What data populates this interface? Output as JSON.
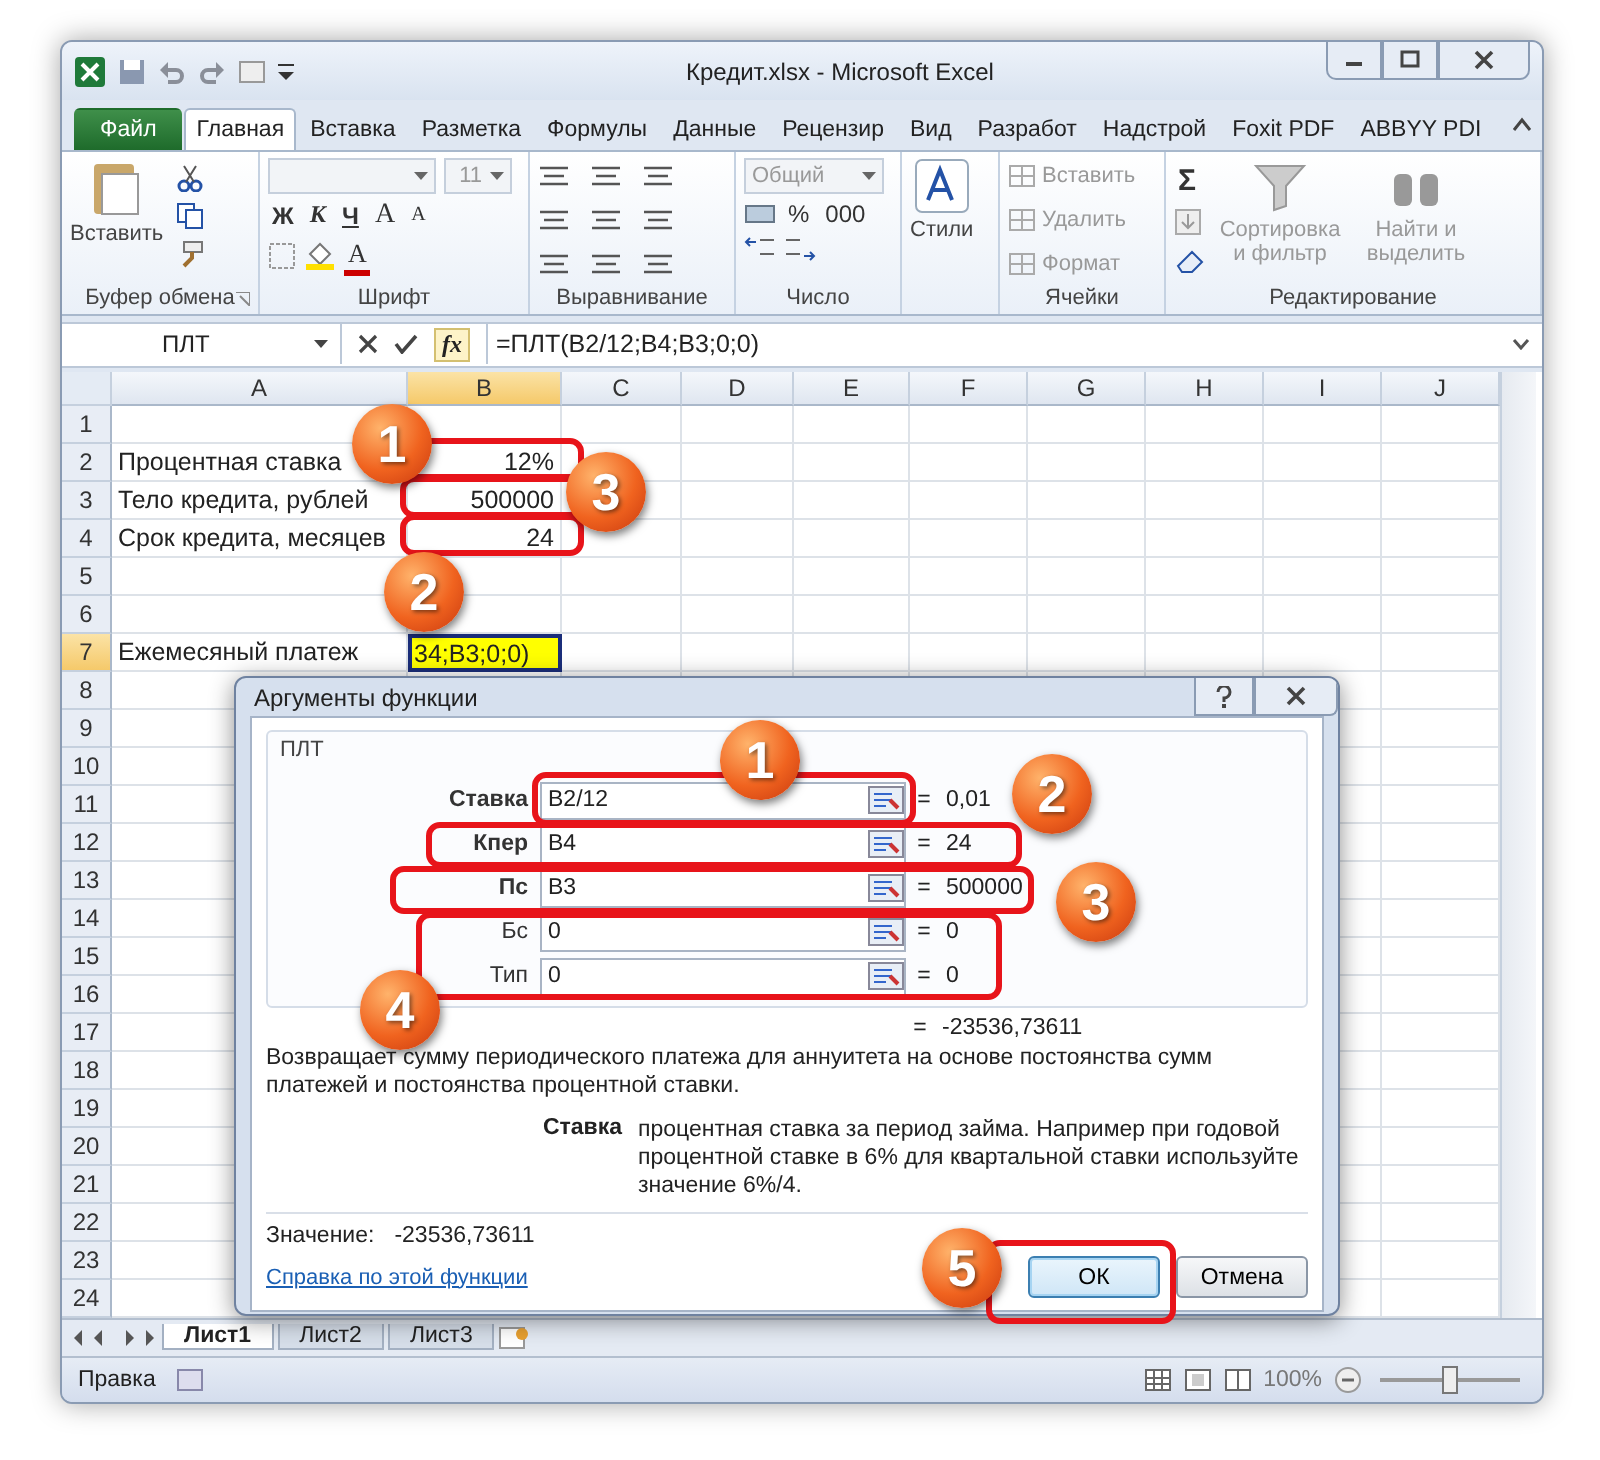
{
  "window": {
    "title": "Кредит.xlsx  -  Microsoft Excel"
  },
  "ribbon_tabs": [
    {
      "label": "Файл",
      "kind": "file",
      "selected": false
    },
    {
      "label": "Главная",
      "kind": "tab",
      "selected": true
    },
    {
      "label": "Вставка",
      "kind": "tab",
      "selected": false
    },
    {
      "label": "Разметка",
      "kind": "tab",
      "selected": false
    },
    {
      "label": "Формулы",
      "kind": "tab",
      "selected": false
    },
    {
      "label": "Данные",
      "kind": "tab",
      "selected": false
    },
    {
      "label": "Рецензир",
      "kind": "tab",
      "selected": false
    },
    {
      "label": "Вид",
      "kind": "tab",
      "selected": false
    },
    {
      "label": "Разработ",
      "kind": "tab",
      "selected": false
    },
    {
      "label": "Надстрой",
      "kind": "tab",
      "selected": false
    },
    {
      "label": "Foxit PDF",
      "kind": "tab",
      "selected": false
    },
    {
      "label": "ABBYY PDI",
      "kind": "tab",
      "selected": false
    }
  ],
  "ribbon": {
    "clipboard": {
      "label": "Буфер обмена",
      "paste": "Вставить"
    },
    "font": {
      "label": "Шрифт",
      "size": "11",
      "styles": [
        "Ж",
        "К",
        "Ч"
      ],
      "grow": "A",
      "shrink": "A",
      "font_color_button": "A"
    },
    "alignment": {
      "label": "Выравнивание"
    },
    "number": {
      "label": "Число",
      "format": "Общий",
      "percent": "%",
      "thousands": "000"
    },
    "styles": {
      "label": "Стили"
    },
    "cells": {
      "label": "Ячейки",
      "items": [
        {
          "label": "Вставить",
          "disabled": true
        },
        {
          "label": "Удалить",
          "disabled": true
        },
        {
          "label": "Формат",
          "disabled": true
        }
      ]
    },
    "editing": {
      "label": "Редактирование",
      "sum": "Σ",
      "items": [
        {
          "label": "Сортировка и фильтр",
          "disabled": true
        },
        {
          "label": "Найти и выделить",
          "disabled": true
        }
      ]
    }
  },
  "formula_bar": {
    "name_box": "ПЛТ",
    "fx": "fx",
    "formula": "=ПЛТ(B2/12;B4;B3;0;0)"
  },
  "columns": [
    "A",
    "B",
    "C",
    "D",
    "E",
    "F",
    "G",
    "H",
    "I",
    "J"
  ],
  "rows": [
    {
      "header": "1",
      "cells": []
    },
    {
      "header": "2",
      "cells": [
        {
          "value": "Процентная ставка",
          "selected": false
        },
        {
          "value": "12%",
          "selected": false
        }
      ]
    },
    {
      "header": "3",
      "cells": [
        {
          "value": "Тело кредита, рублей",
          "selected": false
        },
        {
          "value": "500000",
          "selected": false
        }
      ]
    },
    {
      "header": "4",
      "cells": [
        {
          "value": "Срок кредита, месяцев",
          "selected": false
        },
        {
          "value": "24",
          "selected": false
        }
      ]
    },
    {
      "header": "5",
      "cells": []
    },
    {
      "header": "6",
      "cells": []
    },
    {
      "header": "7",
      "cells": [
        {
          "value": "Ежемесяный платеж",
          "selected": false
        },
        {
          "value": "34;B3;0;0)",
          "selected": true
        }
      ]
    },
    {
      "header": "8",
      "cells": []
    },
    {
      "header": "9",
      "cells": []
    },
    {
      "header": "10",
      "cells": []
    },
    {
      "header": "11",
      "cells": []
    },
    {
      "header": "12",
      "cells": []
    },
    {
      "header": "13",
      "cells": []
    },
    {
      "header": "14",
      "cells": []
    },
    {
      "header": "15",
      "cells": []
    },
    {
      "header": "16",
      "cells": []
    },
    {
      "header": "17",
      "cells": []
    },
    {
      "header": "18",
      "cells": []
    },
    {
      "header": "19",
      "cells": []
    },
    {
      "header": "20",
      "cells": []
    },
    {
      "header": "21",
      "cells": []
    },
    {
      "header": "22",
      "cells": []
    },
    {
      "header": "23",
      "cells": []
    },
    {
      "header": "24",
      "cells": []
    }
  ],
  "sheet_tabs": [
    {
      "label": "Лист1",
      "selected": true
    },
    {
      "label": "Лист2",
      "selected": false
    },
    {
      "label": "Лист3",
      "selected": false
    }
  ],
  "status_bar": {
    "mode": "Правка",
    "zoom": "100%",
    "zoom_slider": {
      "level": 0.5
    }
  },
  "dialog": {
    "title": "Аргументы функции",
    "function": "ПЛТ",
    "arguments": [
      {
        "label": "Ставка",
        "value": "B2/12",
        "sign": "=",
        "result": "0,01",
        "required": true
      },
      {
        "label": "Кпер",
        "value": "B4",
        "sign": "=",
        "result": "24",
        "required": true
      },
      {
        "label": "Пс",
        "value": "B3",
        "sign": "=",
        "result": "500000",
        "required": true
      },
      {
        "label": "Бс",
        "value": "0",
        "sign": "=",
        "result": "0",
        "required": false
      },
      {
        "label": "Тип",
        "value": "0",
        "sign": "=",
        "result": "0",
        "required": false
      }
    ],
    "total": {
      "sign": "=",
      "value": "-23536,73611"
    },
    "description": "Возвращает сумму периодического платежа для аннуитета на основе постоянства сумм платежей и постоянства процентной ставки.",
    "help": {
      "term": "Ставка",
      "text": "процентная ставка за период займа. Например при годовой процентной ставке в 6% для квартальной ставки используйте значение 6%/4."
    },
    "value_label": "Значение:",
    "value": "-23536,73611",
    "help_link": "Справка по этой функции",
    "buttons": [
      {
        "label": "ОК",
        "default": true
      },
      {
        "label": "Отмена",
        "default": false
      }
    ]
  },
  "callouts": [
    {
      "number": "1"
    },
    {
      "number": "3"
    },
    {
      "number": "2"
    },
    {
      "number": "1"
    },
    {
      "number": "2"
    },
    {
      "number": "3"
    },
    {
      "number": "4"
    },
    {
      "number": "5"
    }
  ]
}
